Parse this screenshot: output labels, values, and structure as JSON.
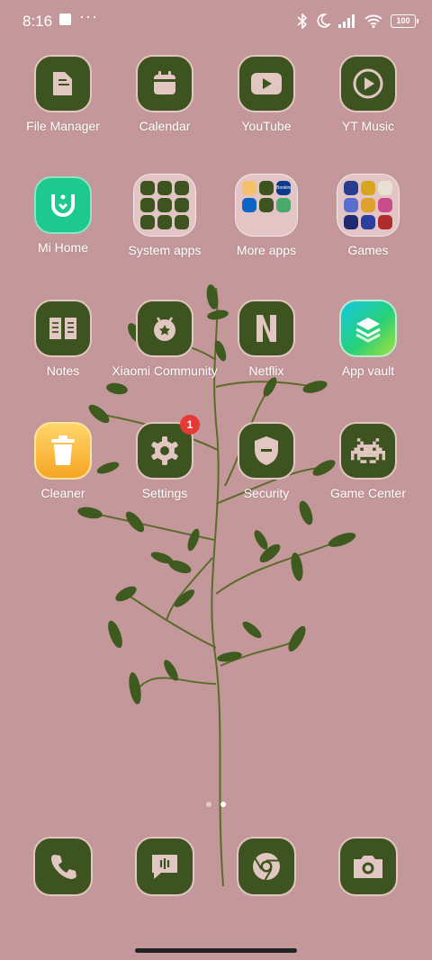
{
  "status": {
    "time": "8:16",
    "battery": "100"
  },
  "apps": [
    {
      "label": "File Manager"
    },
    {
      "label": "Calendar"
    },
    {
      "label": "YouTube"
    },
    {
      "label": "YT Music"
    },
    {
      "label": "Mi Home"
    },
    {
      "label": "System apps"
    },
    {
      "label": "More apps"
    },
    {
      "label": "Games"
    },
    {
      "label": "Notes"
    },
    {
      "label": "Xiaomi Community"
    },
    {
      "label": "Netflix"
    },
    {
      "label": "App vault"
    },
    {
      "label": "Cleaner"
    },
    {
      "label": "Settings",
      "badge": "1"
    },
    {
      "label": "Security"
    },
    {
      "label": "Game Center"
    }
  ],
  "folders": {
    "system_apps": {
      "mini_icons": [
        "grid-icon",
        "phone-icon",
        "download-icon",
        "gallery-icon",
        "settings-icon",
        "mail-icon",
        "clock-icon",
        "music-icon",
        "compass-icon"
      ]
    },
    "more_apps": {
      "mini_icons": [
        "amazon-icon",
        "facebook-icon",
        "booking-icon",
        "linkedin-icon",
        "spotify-icon",
        "photos-icon"
      ],
      "mini_text": "Booking"
    },
    "games": {
      "mini_icons": [
        "game-1-icon",
        "game-2-icon",
        "game-3-icon",
        "game-4-icon",
        "game-5-icon",
        "game-6-icon",
        "game-7-icon",
        "game-8-icon",
        "game-9-icon"
      ]
    }
  },
  "dock": [
    {
      "icon": "phone-icon"
    },
    {
      "icon": "messages-icon"
    },
    {
      "icon": "chrome-icon"
    },
    {
      "icon": "camera-icon"
    }
  ],
  "page_indicator": {
    "count": 2,
    "active": 2
  },
  "colors": {
    "background": "#c4979a",
    "icon_fill": "#3d5420",
    "icon_glyph": "#e2c6c1",
    "badge": "#e53935"
  }
}
